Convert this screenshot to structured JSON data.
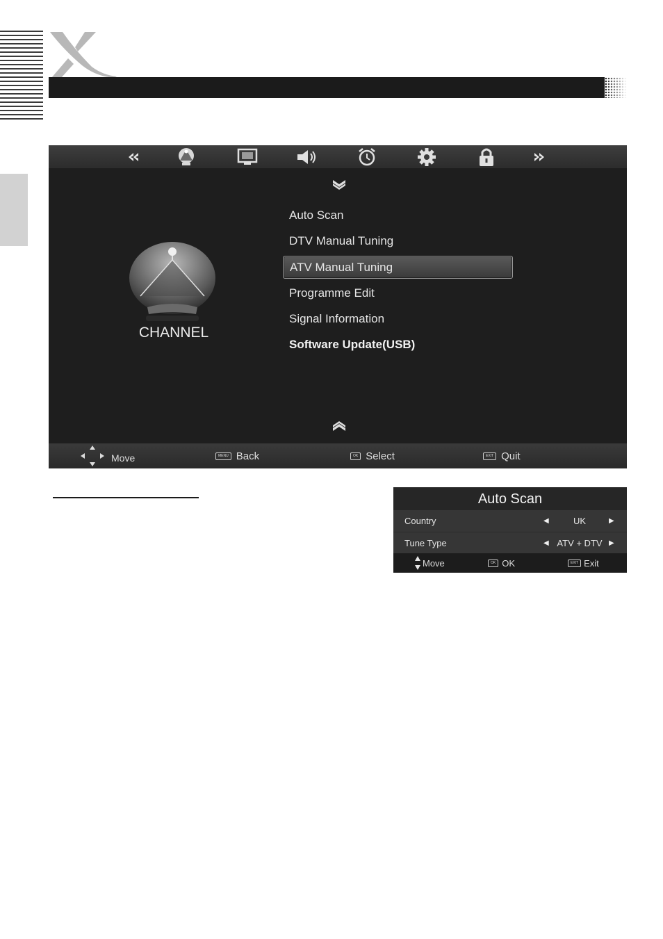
{
  "header": {
    "logo_letter": "X"
  },
  "main_menu": {
    "top_icons": [
      "chevrons-left-icon",
      "satellite-dish-icon",
      "picture-monitor-icon",
      "speaker-icon",
      "alarm-clock-icon",
      "gear-icon",
      "padlock-icon",
      "chevrons-right-icon"
    ],
    "items": [
      {
        "label": "Auto Scan"
      },
      {
        "label": "DTV Manual Tuning"
      },
      {
        "label": "ATV Manual Tuning",
        "selected": true
      },
      {
        "label": "Programme Edit"
      },
      {
        "label": "Signal Information"
      },
      {
        "label": "Software Update(USB)"
      }
    ],
    "category_label": "CHANNEL",
    "footer": {
      "move": "Move",
      "back_key": "MENU",
      "back": "Back",
      "select_key": "OK",
      "select": "Select",
      "quit_key": "EXIT",
      "quit": "Quit"
    }
  },
  "auto_scan_dialog": {
    "title": "Auto Scan",
    "rows": [
      {
        "label": "Country",
        "value": "UK"
      },
      {
        "label": "Tune Type",
        "value": "ATV + DTV"
      }
    ],
    "footer": {
      "move": "Move",
      "ok_key": "OK",
      "ok": "OK",
      "exit_key": "EXIT",
      "exit": "Exit"
    }
  },
  "colors": {
    "screen_bg": "#1e1e1e",
    "banner": "#1b1b1b",
    "tab_gray": "#d2d2d2"
  }
}
